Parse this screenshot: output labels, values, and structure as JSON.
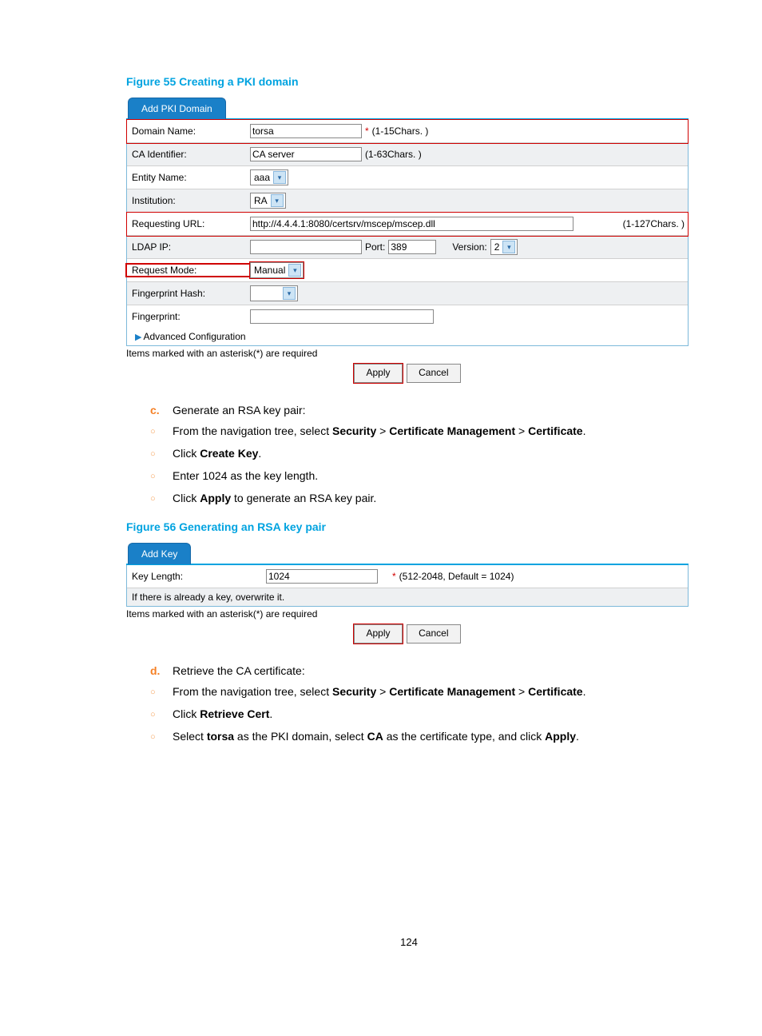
{
  "fig55": {
    "title": "Figure 55 Creating a PKI domain",
    "tab": "Add PKI Domain",
    "rows": {
      "domain_name": {
        "label": "Domain Name:",
        "value": "torsa",
        "hint": "(1-15Chars. )",
        "req": "*"
      },
      "ca_identifier": {
        "label": "CA Identifier:",
        "value": "CA server",
        "hint": "(1-63Chars. )"
      },
      "entity_name": {
        "label": "Entity Name:",
        "value": "aaa"
      },
      "institution": {
        "label": "Institution:",
        "value": "RA"
      },
      "req_url": {
        "label": "Requesting URL:",
        "value": "http://4.4.4.1:8080/certsrv/mscep/mscep.dll",
        "hint": "(1-127Chars. )"
      },
      "ldap_ip": {
        "label": "LDAP IP:",
        "port_label": "Port:",
        "port_value": "389",
        "version_label": "Version:",
        "version_value": "2"
      },
      "request_mode": {
        "label": "Request Mode:",
        "value": "Manual"
      },
      "fingerprint_hash": {
        "label": "Fingerprint Hash:",
        "value": ""
      },
      "fingerprint": {
        "label": "Fingerprint:",
        "value": ""
      }
    },
    "advanced": "Advanced Configuration",
    "note": "Items marked with an asterisk(*) are required",
    "apply": "Apply",
    "cancel": "Cancel"
  },
  "step_c": {
    "letter": "c.",
    "text": "Generate an RSA key pair:"
  },
  "step_c_subs": {
    "s1_a": "From the navigation tree, select ",
    "s1_b1": "Security",
    "s1_gt1": " > ",
    "s1_b2": "Certificate Management",
    "s1_gt2": " > ",
    "s1_b3": "Certificate",
    "s1_end": ".",
    "s2_a": "Click ",
    "s2_b": "Create Key",
    "s2_end": ".",
    "s3": "Enter 1024 as the key length.",
    "s4_a": "Click ",
    "s4_b": "Apply",
    "s4_end": " to generate an RSA key pair."
  },
  "fig56": {
    "title": "Figure 56 Generating an RSA key pair",
    "tab": "Add Key",
    "key_length": {
      "label": "Key Length:",
      "value": "1024",
      "req": "*",
      "hint": "(512-2048, Default = 1024)"
    },
    "overwrite": "If there is already a key, overwrite it.",
    "note": "Items marked with an asterisk(*) are required",
    "apply": "Apply",
    "cancel": "Cancel"
  },
  "step_d": {
    "letter": "d.",
    "text": "Retrieve the CA certificate:"
  },
  "step_d_subs": {
    "s1_a": "From the navigation tree, select ",
    "s1_b1": "Security",
    "s1_gt1": " > ",
    "s1_b2": "Certificate Management",
    "s1_gt2": " > ",
    "s1_b3": "Certificate",
    "s1_end": ".",
    "s2_a": "Click ",
    "s2_b": "Retrieve Cert",
    "s2_end": ".",
    "s3_a": "Select ",
    "s3_b1": "torsa",
    "s3_c": " as the PKI domain, select ",
    "s3_b2": "CA",
    "s3_d": " as the certificate type, and click ",
    "s3_b3": "Apply",
    "s3_end": "."
  },
  "page_number": "124"
}
